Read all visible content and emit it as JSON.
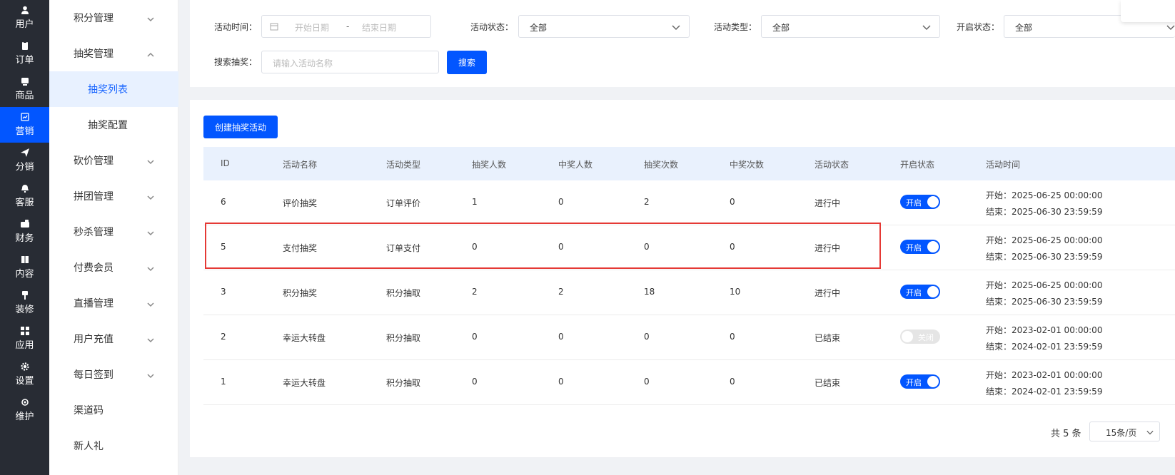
{
  "rail": [
    {
      "label": "用户",
      "icon": "user-icon"
    },
    {
      "label": "订单",
      "icon": "order-icon"
    },
    {
      "label": "商品",
      "icon": "goods-icon"
    },
    {
      "label": "营销",
      "icon": "marketing-icon",
      "active": true
    },
    {
      "label": "分销",
      "icon": "send-icon"
    },
    {
      "label": "客服",
      "icon": "bell-icon"
    },
    {
      "label": "财务",
      "icon": "wallet-icon"
    },
    {
      "label": "内容",
      "icon": "book-icon"
    },
    {
      "label": "装修",
      "icon": "brush-icon"
    },
    {
      "label": "应用",
      "icon": "grid-icon"
    },
    {
      "label": "设置",
      "icon": "gear-icon"
    },
    {
      "label": "维护",
      "icon": "chip-icon"
    }
  ],
  "subnav": [
    {
      "label": "积分管理",
      "chevron": "down"
    },
    {
      "label": "抽奖管理",
      "chevron": "up"
    },
    {
      "label": "抽奖列表",
      "child": true,
      "active": true
    },
    {
      "label": "抽奖配置",
      "child": true
    },
    {
      "label": "砍价管理",
      "chevron": "down"
    },
    {
      "label": "拼团管理",
      "chevron": "down"
    },
    {
      "label": "秒杀管理",
      "chevron": "down"
    },
    {
      "label": "付费会员",
      "chevron": "down"
    },
    {
      "label": "直播管理",
      "chevron": "down"
    },
    {
      "label": "用户充值",
      "chevron": "down"
    },
    {
      "label": "每日签到",
      "chevron": "down"
    },
    {
      "label": "渠道码"
    },
    {
      "label": "新人礼"
    }
  ],
  "filters": {
    "time_label": "活动时间：",
    "start_placeholder": "开始日期",
    "range_sep": "-",
    "end_placeholder": "结束日期",
    "status_label": "活动状态：",
    "status_value": "全部",
    "type_label": "活动类型：",
    "type_value": "全部",
    "open_label": "开启状态：",
    "open_value": "全部",
    "search_label": "搜索抽奖：",
    "search_placeholder": "请输入活动名称",
    "search_button": "搜索"
  },
  "create_button": "创建抽奖活动",
  "table": {
    "headers": [
      "ID",
      "活动名称",
      "活动类型",
      "抽奖人数",
      "中奖人数",
      "抽奖次数",
      "中奖次数",
      "活动状态",
      "开启状态",
      "活动时间"
    ],
    "rows": [
      {
        "id": "6",
        "name": "评价抽奖",
        "type": "订单评价",
        "draw_users": "1",
        "win_users": "0",
        "draw_times": "2",
        "win_times": "0",
        "status": "进行中",
        "open": true,
        "open_label": "开启",
        "start": "开始：2025-06-25 00:00:00",
        "end": "结束：2025-06-30 23:59:59"
      },
      {
        "id": "5",
        "name": "支付抽奖",
        "type": "订单支付",
        "draw_users": "0",
        "win_users": "0",
        "draw_times": "0",
        "win_times": "0",
        "status": "进行中",
        "open": true,
        "open_label": "开启",
        "start": "开始：2025-06-25 00:00:00",
        "end": "结束：2025-06-30 23:59:59"
      },
      {
        "id": "3",
        "name": "积分抽奖",
        "type": "积分抽取",
        "draw_users": "2",
        "win_users": "2",
        "draw_times": "18",
        "win_times": "10",
        "status": "进行中",
        "open": true,
        "open_label": "开启",
        "start": "开始：2025-06-25 00:00:00",
        "end": "结束：2025-06-30 23:59:59"
      },
      {
        "id": "2",
        "name": "幸运大转盘",
        "type": "积分抽取",
        "draw_users": "0",
        "win_users": "0",
        "draw_times": "0",
        "win_times": "0",
        "status": "已结束",
        "open": false,
        "open_label": "关闭",
        "start": "开始：2023-02-01 00:00:00",
        "end": "结束：2024-02-01 23:59:59"
      },
      {
        "id": "1",
        "name": "幸运大转盘",
        "type": "积分抽取",
        "draw_users": "0",
        "win_users": "0",
        "draw_times": "0",
        "win_times": "0",
        "status": "已结束",
        "open": true,
        "open_label": "开启",
        "start": "开始：2023-02-01 00:00:00",
        "end": "结束：2024-02-01 23:59:59"
      }
    ]
  },
  "pager": {
    "total": "共 5 条",
    "page_size": "15条/页"
  },
  "colors": {
    "accent": "#0256ff",
    "rail": "#282c34",
    "highlight": "#e53935"
  }
}
